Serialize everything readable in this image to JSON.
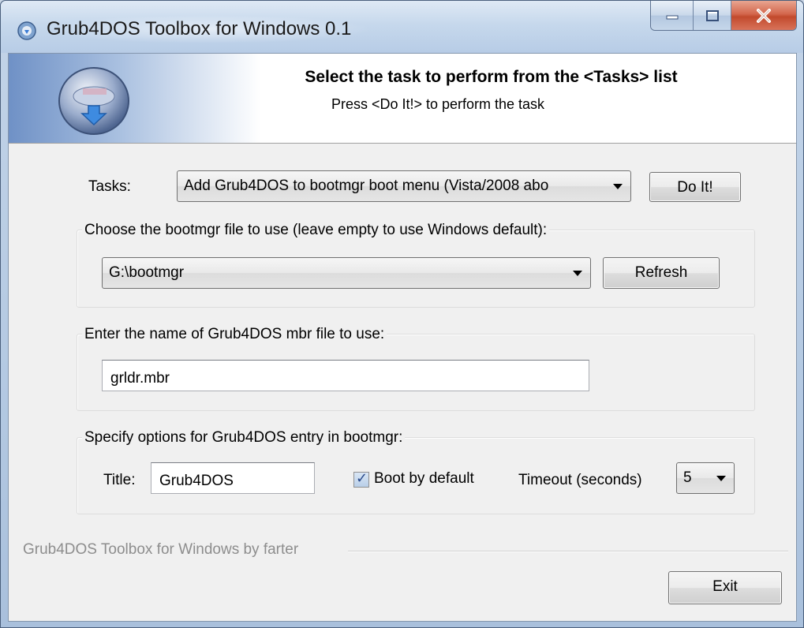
{
  "window": {
    "title": "Grub4DOS Toolbox for Windows 0.1",
    "icons": {
      "app": "toolbox-app-icon",
      "minimize": "minimize-icon",
      "maximize": "maximize-icon",
      "close": "close-icon"
    },
    "accent_color": "#c24a2d"
  },
  "header": {
    "title": "Select the task to perform from the <Tasks> list",
    "subtitle": "Press <Do It!> to perform the task",
    "logo_icon": "disk-download-logo-icon"
  },
  "tasks": {
    "label": "Tasks:",
    "selected": "Add Grub4DOS to bootmgr boot menu (Vista/2008 abo",
    "do_it_label": "Do It!"
  },
  "bootmgr_group": {
    "title": "Choose the bootmgr file to use (leave empty to use Windows default):",
    "selected": "G:\\bootmgr",
    "refresh_label": "Refresh"
  },
  "mbr_group": {
    "title": "Enter the name of Grub4DOS mbr file to use:",
    "value": "grldr.mbr"
  },
  "options_group": {
    "title": "Specify options for Grub4DOS entry in bootmgr:",
    "title_label": "Title:",
    "title_value": "Grub4DOS",
    "boot_default_label": "Boot by default",
    "boot_default_checked": true,
    "timeout_label": "Timeout (seconds)",
    "timeout_value": "5"
  },
  "footer": {
    "credit": "Grub4DOS Toolbox for Windows by farter",
    "exit_label": "Exit"
  }
}
